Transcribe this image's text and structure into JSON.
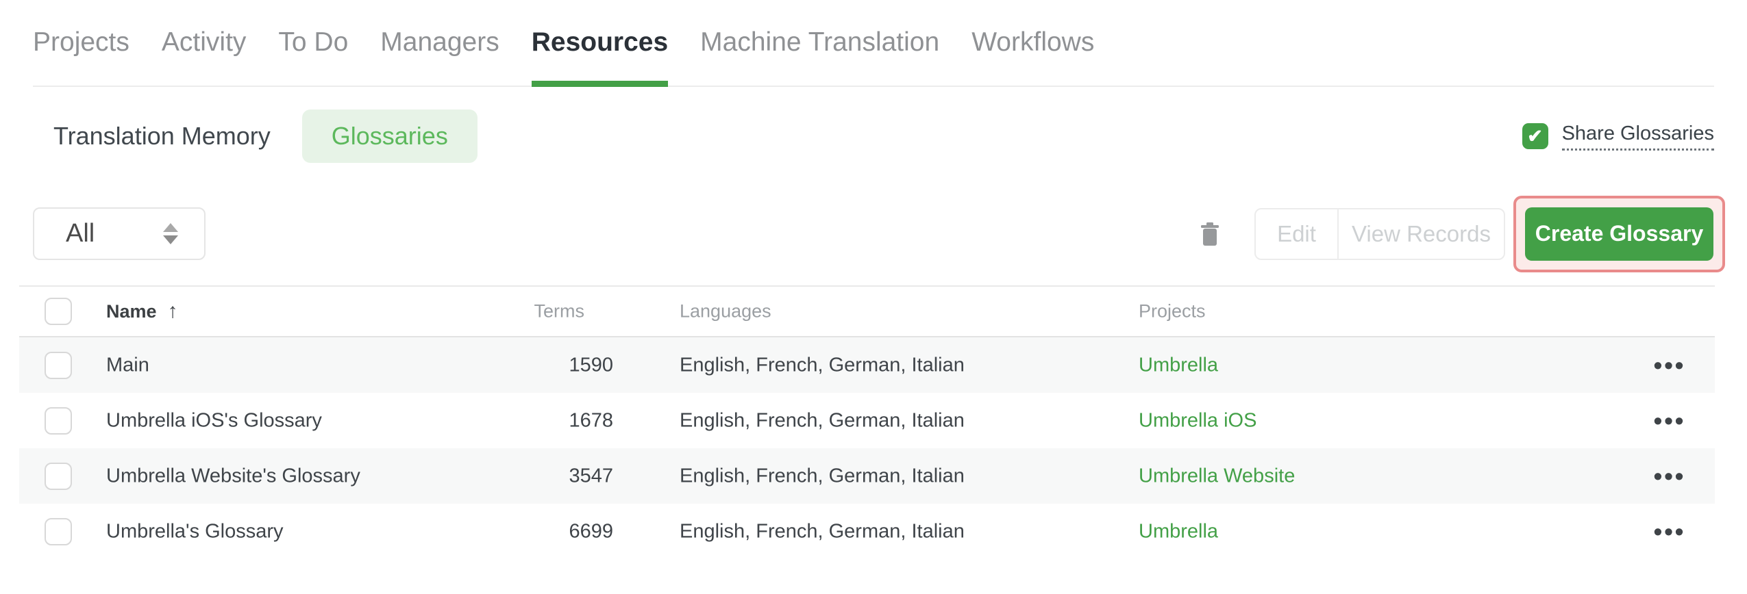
{
  "nav": {
    "tabs": [
      {
        "label": "Projects"
      },
      {
        "label": "Activity"
      },
      {
        "label": "To Do"
      },
      {
        "label": "Managers"
      },
      {
        "label": "Resources"
      },
      {
        "label": "Machine Translation"
      },
      {
        "label": "Workflows"
      }
    ],
    "active_tab": "Resources"
  },
  "subnav": {
    "items": [
      {
        "label": "Translation Memory"
      },
      {
        "label": "Glossaries"
      }
    ],
    "active_item": "Glossaries",
    "share_label": "Share Glossaries",
    "share_checked": true
  },
  "controls": {
    "filter_value": "All",
    "edit_label": "Edit",
    "view_records_label": "View Records",
    "create_label": "Create Glossary",
    "edit_enabled": false,
    "view_records_enabled": false
  },
  "table": {
    "headers": {
      "name": "Name",
      "terms": "Terms",
      "languages": "Languages",
      "projects": "Projects"
    },
    "sort": {
      "column": "Name",
      "direction": "asc"
    },
    "rows": [
      {
        "name": "Main",
        "terms": "1590",
        "languages": "English, French, German, Italian",
        "project": "Umbrella",
        "checked": false
      },
      {
        "name": "Umbrella iOS's Glossary",
        "terms": "1678",
        "languages": "English, French, German, Italian",
        "project": "Umbrella iOS",
        "checked": false
      },
      {
        "name": "Umbrella Website's Glossary",
        "terms": "3547",
        "languages": "English, French, German, Italian",
        "project": "Umbrella Website",
        "checked": false
      },
      {
        "name": "Umbrella's Glossary",
        "terms": "6699",
        "languages": "English, French, German, Italian",
        "project": "Umbrella",
        "checked": false
      }
    ]
  },
  "icons": {
    "sort_asc": "↑",
    "row_menu": "•••",
    "share_check": "✔",
    "trash": "trash-icon",
    "dropdown_sorter": "up-down-triangles"
  },
  "colors": {
    "accent_green": "#43a047",
    "glossaries_pill_bg": "#e7f3e7",
    "glossaries_pill_text": "#5cb85c",
    "link_green": "#43a047",
    "disabled_button_text": "#cdd0d2",
    "annotation_border": "#e98b8b",
    "annotation_bg": "#fcebe9",
    "zebra_row_bg": "#f7f8f8",
    "header_text": "#9b9fa3",
    "body_text": "#3f4449",
    "inactive_tab_text": "#8f9194",
    "active_tab_text": "#2b3138"
  }
}
